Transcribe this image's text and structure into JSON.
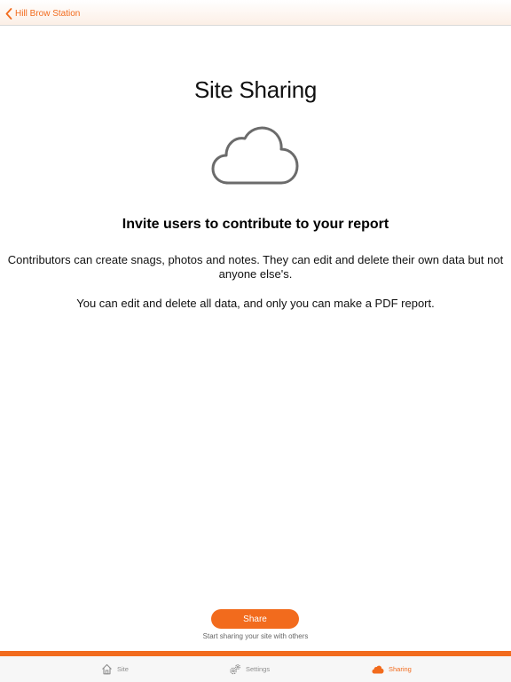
{
  "nav": {
    "back_label": "Hill Brow Station",
    "back_icon": "chevron-left-icon"
  },
  "main": {
    "title": "Site Sharing",
    "illustration_icon": "cloud-icon",
    "headline": "Invite users to contribute to your report",
    "paragraph_1": "Contributors can create snags, photos and notes. They can edit and delete their own data but not anyone else's.",
    "paragraph_2": "You can edit and delete all data, and only you can make a PDF report."
  },
  "share": {
    "button_label": "Share",
    "hint": "Start sharing your site with others"
  },
  "tabs": [
    {
      "label": "Site",
      "icon": "house-icon",
      "selected": false
    },
    {
      "label": "Settings",
      "icon": "gears-icon",
      "selected": false
    },
    {
      "label": "Sharing",
      "icon": "cloud-icon",
      "selected": true
    }
  ],
  "colors": {
    "accent": "#f26b1d",
    "tab_inactive": "#8e8e8e",
    "text": "#111111",
    "icon_stroke": "#6b6b6b"
  }
}
